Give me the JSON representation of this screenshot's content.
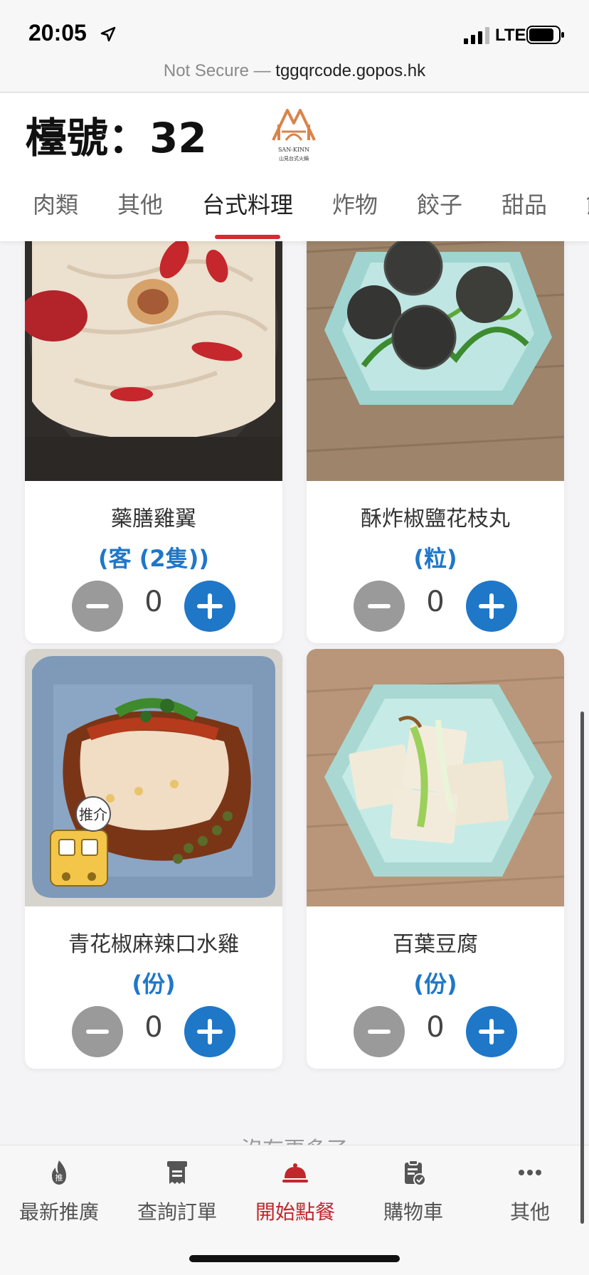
{
  "status_bar": {
    "time": "20:05",
    "network": "LTE"
  },
  "url_bar": {
    "security": "Not Secure —",
    "host": "tggqrcode.gopos.hk"
  },
  "header": {
    "table_label": "檯號：32",
    "logo_brand": "SAN-KINN",
    "logo_sub": "山見台式火鍋"
  },
  "tabs": [
    {
      "label": "肉類",
      "active": false
    },
    {
      "label": "其他",
      "active": false
    },
    {
      "label": "台式料理",
      "active": true
    },
    {
      "label": "炸物",
      "active": false
    },
    {
      "label": "餃子",
      "active": false
    },
    {
      "label": "甜品",
      "active": false
    },
    {
      "label": "飲",
      "active": false
    }
  ],
  "items": [
    {
      "name": "藥膳雞翼",
      "unit": "(客 (2隻))",
      "qty": "0"
    },
    {
      "name": "酥炸椒鹽花枝丸",
      "unit": "(粒)",
      "qty": "0"
    },
    {
      "name": "青花椒麻辣口水雞",
      "unit": "(份)",
      "qty": "0",
      "badge": "推介"
    },
    {
      "name": "百葉豆腐",
      "unit": "(份)",
      "qty": "0"
    }
  ],
  "end_text": "沒有更多了",
  "bottom_nav": [
    {
      "label": "最新推廣",
      "icon": "fire-icon",
      "active": false
    },
    {
      "label": "查詢訂單",
      "icon": "receipt-icon",
      "active": false
    },
    {
      "label": "開始點餐",
      "icon": "cloche-icon",
      "active": true
    },
    {
      "label": "購物車",
      "icon": "clipboard-check-icon",
      "active": false
    },
    {
      "label": "其他",
      "icon": "more-icon",
      "active": false
    }
  ],
  "colors": {
    "accent_red": "#d62b32",
    "plus_blue": "#1f77c8",
    "minus_gray": "#9a9a9a",
    "logo_orange": "#d9834a"
  }
}
